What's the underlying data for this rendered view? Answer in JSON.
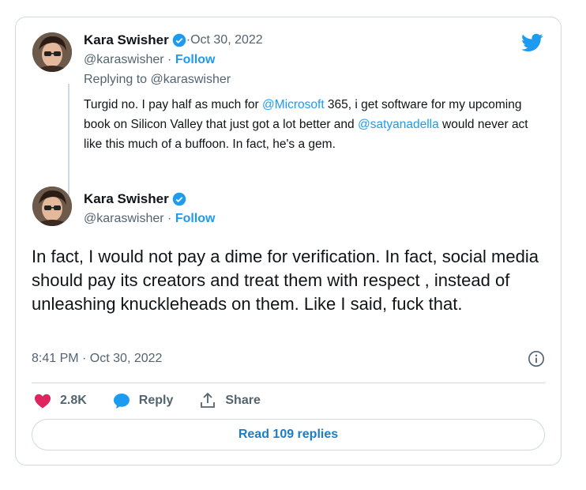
{
  "colors": {
    "accent": "#1d9bf0",
    "like": "#e0245e",
    "text": "#0f1419",
    "muted": "#536471",
    "border": "#cfd9de"
  },
  "quoted_tweet": {
    "author_name": "Kara Swisher",
    "separator": " · ",
    "date": "Oct 30, 2022",
    "handle": "@karaswisher",
    "follow_label": "Follow",
    "replying_to": "Replying to @karaswisher",
    "text_parts": {
      "p1": "Turgid no. I pay half as much for ",
      "mention1": "@Microsoft",
      "p2": " 365, i get software for my upcoming book on Silicon Valley that just got a lot better and ",
      "mention2": "@satyanadella",
      "p3": " would never act like this much of a buffoon. In fact, he's a gem."
    }
  },
  "main_tweet": {
    "author_name": "Kara Swisher",
    "handle": "@karaswisher",
    "separator": " · ",
    "follow_label": "Follow",
    "text": "In fact, I would not pay a dime for verification. In fact, social media should pay its creators and treat them with respect , instead of unleashing knuckleheads on them. Like I said, fuck that.",
    "timestamp": "8:41 PM · Oct 30, 2022"
  },
  "actions": {
    "likes": "2.8K",
    "reply_label": "Reply",
    "share_label": "Share"
  },
  "read_replies_label": "Read 109 replies",
  "icons": [
    "twitter-bird-icon",
    "verified-badge-icon",
    "info-icon",
    "heart-icon",
    "reply-bubble-icon",
    "share-icon"
  ]
}
